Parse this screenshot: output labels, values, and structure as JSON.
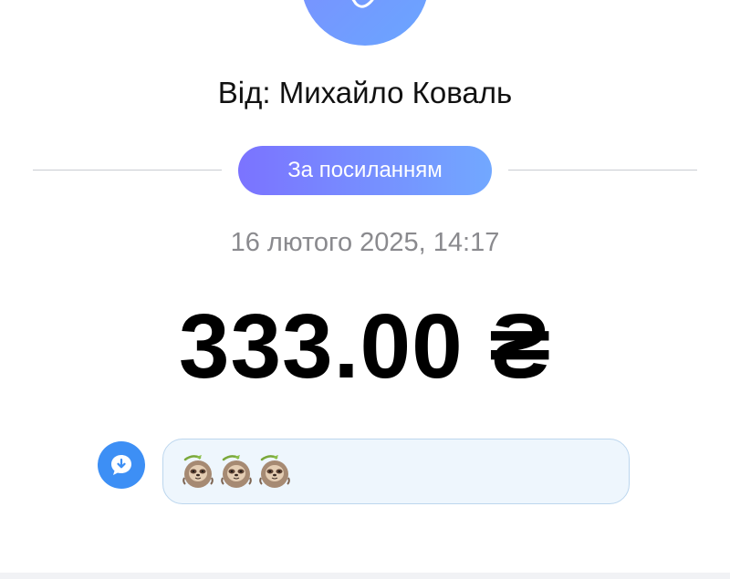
{
  "sender": {
    "label": "Від: Михайло Коваль"
  },
  "transfer_type": {
    "label": "За посиланням"
  },
  "datetime": "16 лютого 2025, 14:17",
  "amount": "333.00 ₴",
  "comment": {
    "icon": "comment-download-icon",
    "emojis": [
      "sloth",
      "sloth",
      "sloth"
    ]
  },
  "colors": {
    "accent_gradient_start": "#7b73ff",
    "accent_gradient_end": "#72a8ff",
    "comment_icon": "#3d8ff5",
    "comment_bubble_bg": "#eef6fd"
  }
}
